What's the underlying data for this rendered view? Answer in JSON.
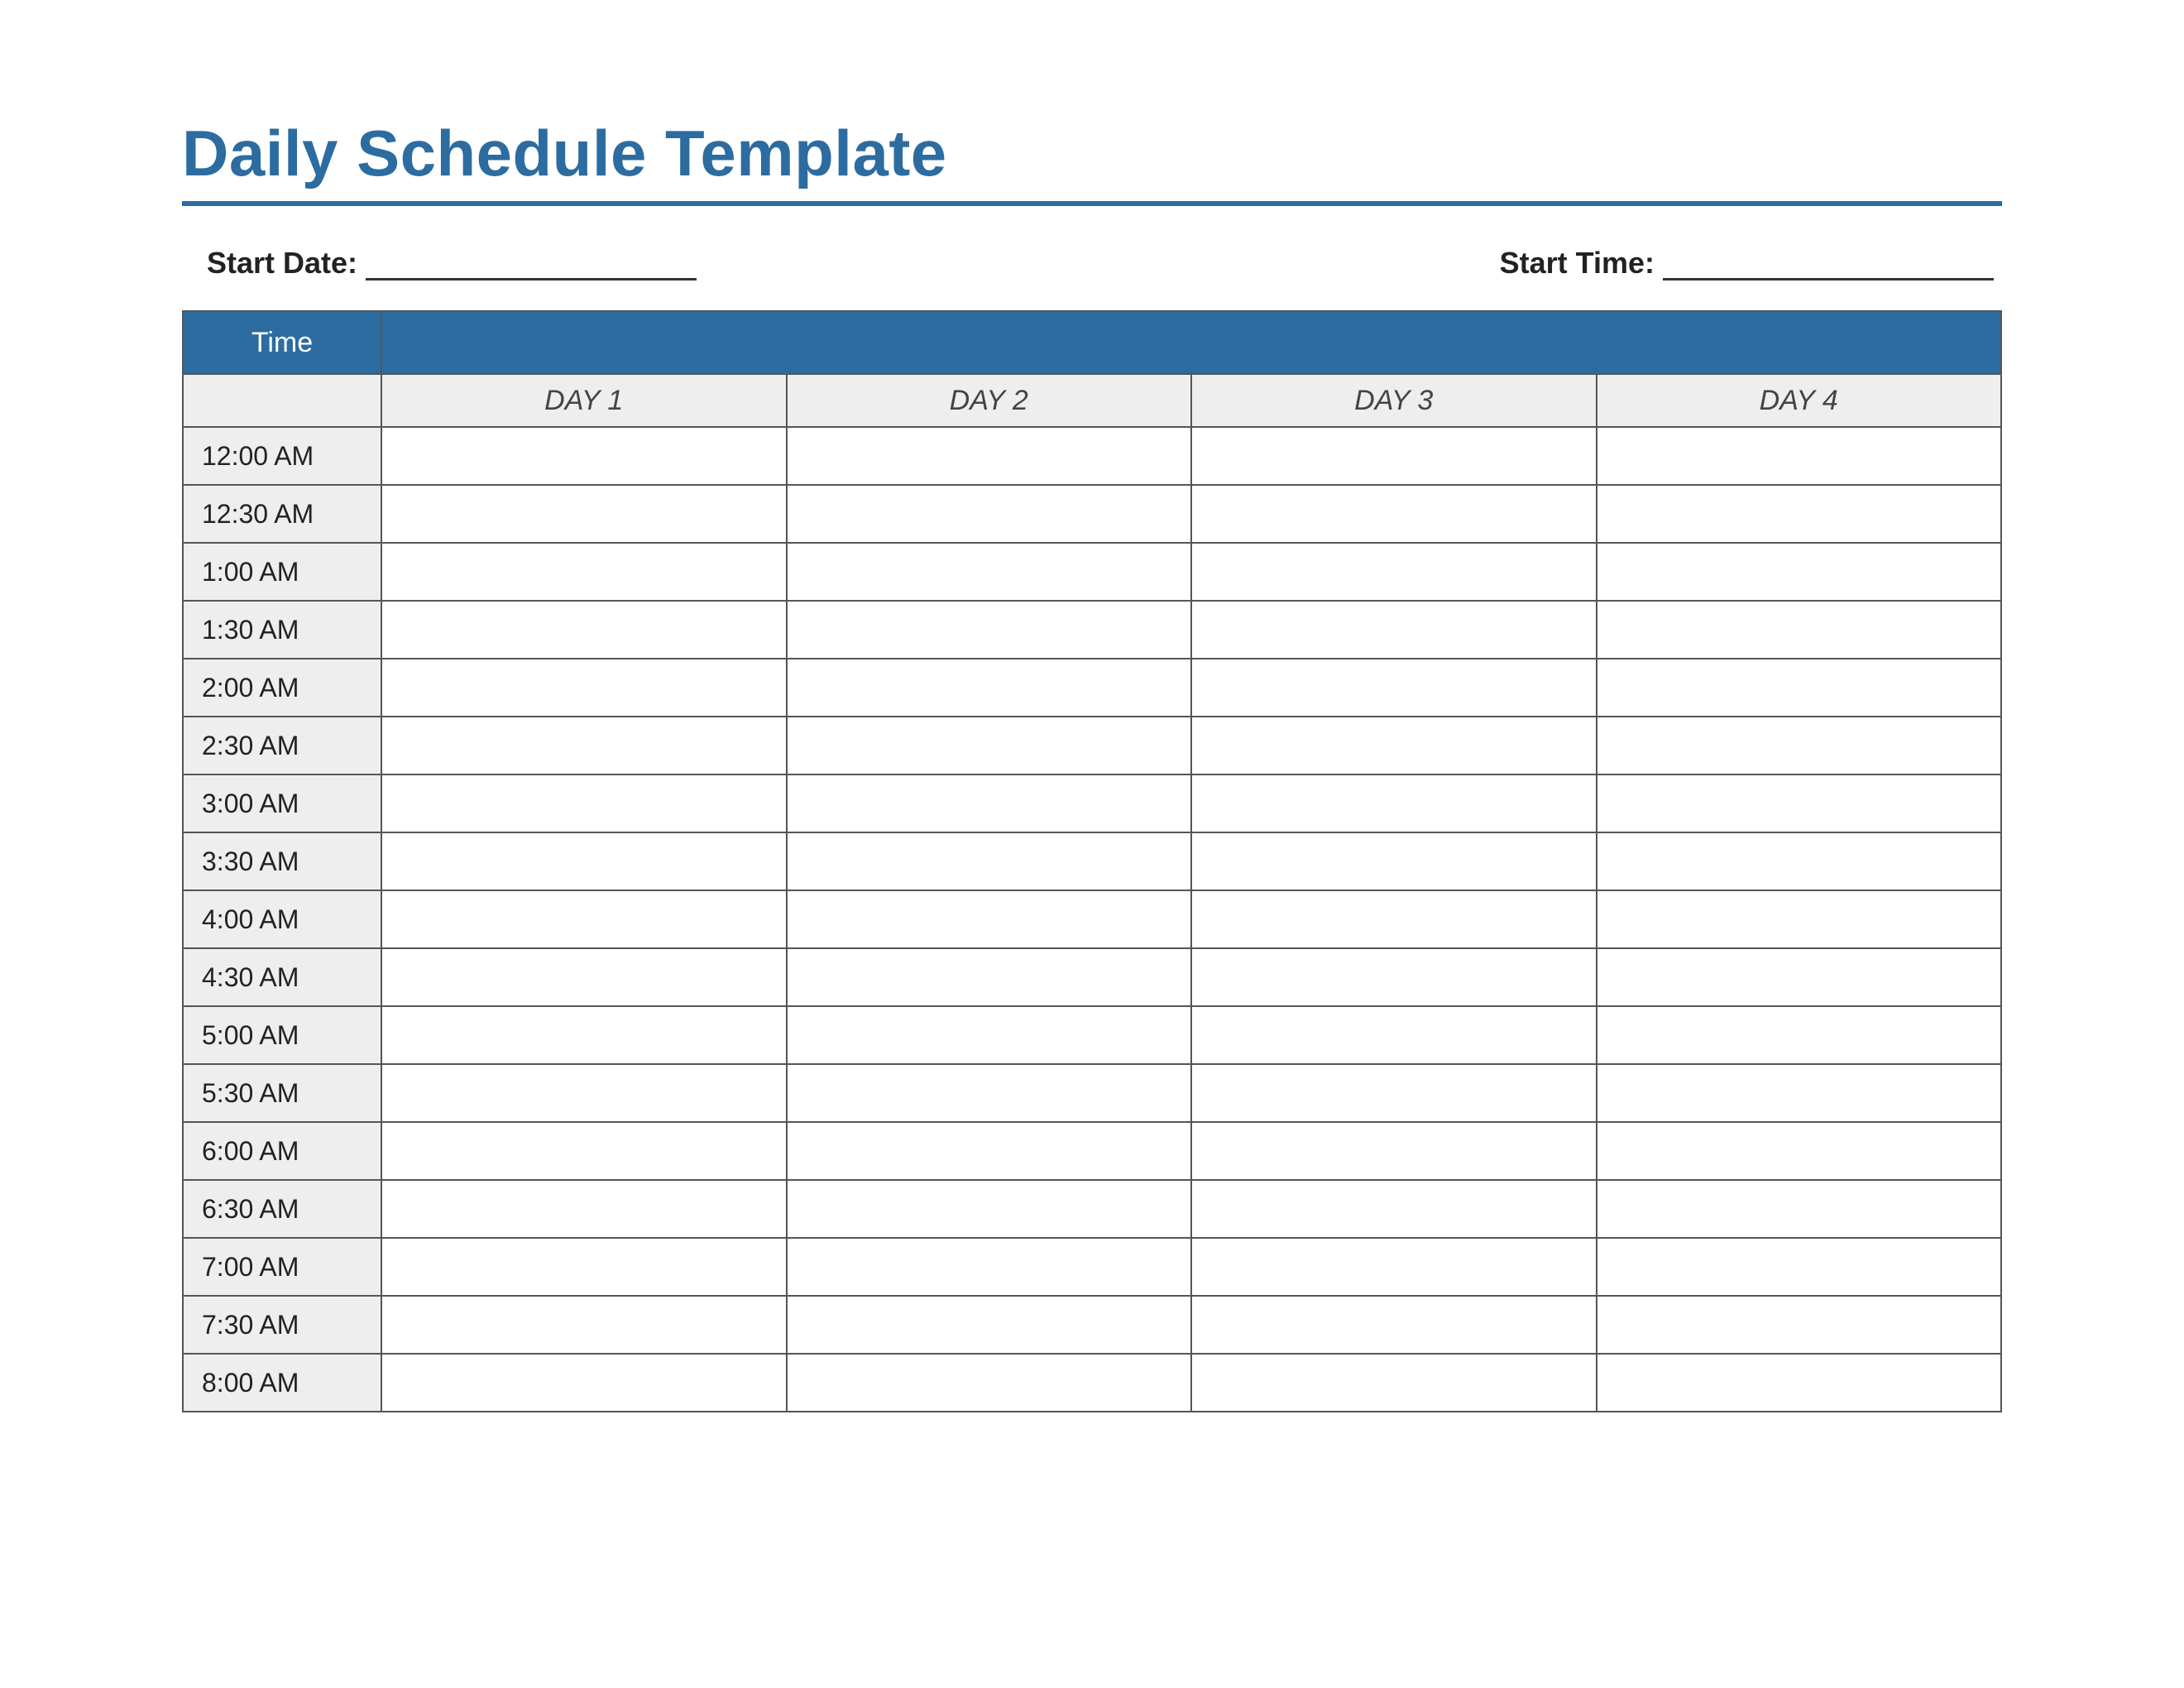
{
  "title": "Daily Schedule Template",
  "meta": {
    "start_date_label": "Start Date:",
    "start_date_value": "",
    "start_time_label": "Start Time:",
    "start_time_value": ""
  },
  "table": {
    "time_header": "Time",
    "day_headers": [
      "DAY 1",
      "DAY 2",
      "DAY 3",
      "DAY 4"
    ],
    "time_slots": [
      "12:00 AM",
      "12:30 AM",
      "1:00 AM",
      "1:30 AM",
      "2:00 AM",
      "2:30 AM",
      "3:00 AM",
      "3:30 AM",
      "4:00 AM",
      "4:30 AM",
      "5:00 AM",
      "5:30 AM",
      "6:00 AM",
      "6:30 AM",
      "7:00 AM",
      "7:30 AM",
      "8:00 AM"
    ]
  }
}
